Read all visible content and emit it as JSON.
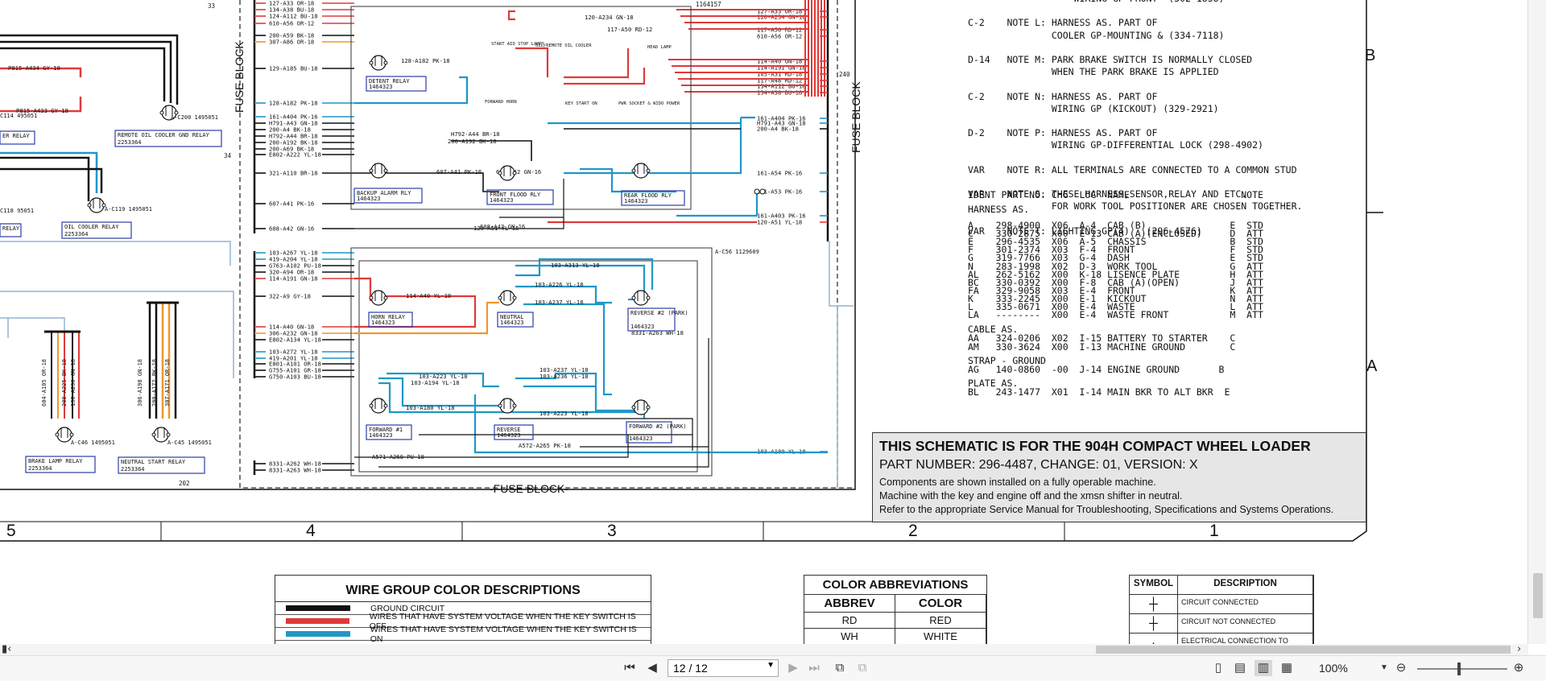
{
  "schematic": {
    "fuse_block_label": "FUSE BLOCK",
    "wire_labels_left": [
      "127-A33 OR-18",
      "134-A38 BU-18",
      "124-A112 BU-18",
      "610-A56 OR-12",
      "200-A59 BK-18",
      "307-A86 OR-18",
      "129-A185 BU-18",
      "128-A182 PK-18",
      "161-A404 PK-16",
      "H791-A43 GN-18",
      "200-A4 BK-18",
      "H792-A44 BR-18",
      "200-A192 BK-18",
      "200-A69 BK-18",
      "E802-A222 YL-18",
      "321-A110 BR-18",
      "607-A41 PK-16",
      "608-A42 GN-16",
      "103-A267 YL-18",
      "419-A204 YL-18",
      "G763-A102 PU-18",
      "320-A94 OR-18",
      "114-A191 GN-18",
      "322-A9 GY-18",
      "114-A40 GN-18",
      "306-A232 GN-18",
      "E802-A134 YL-18",
      "103-A272 YL-18",
      "419-A201 YL-18",
      "E801-A101 OR-18",
      "G755-A101 GR-18",
      "G750-A103 BU-18",
      "8331-A262 WH-18",
      "8331-A263 WH-18"
    ],
    "wire_labels_right": [
      "127-A33 OR-18",
      "120-A234 GN-18",
      "117-A50 RD-12",
      "610-A56 OR-12",
      "114-A40 GN-18",
      "114-A191 GN-18",
      "105-A31 RD-18",
      "117-A48 RD-12",
      "134-A112 BU-18",
      "134-A38 BU-18",
      "161-A404 PK-16",
      "H791-A43 GN-18",
      "200-A4 BK-18",
      "161-A54 PK-16",
      "161-A53 PK-16",
      "161-A403 PK-16",
      "120-A51 YL-18",
      "103-A180 YL-18"
    ],
    "wire_labels_mid": [
      "128-A182 PK-18",
      "P815-A434 GY-18",
      "P815-A433 GY-18",
      "607-A41 PK-16",
      "608-A42 GN-16",
      "120-A51 YL-18",
      "608-A42 GN-16",
      "H792-A44 BR-18",
      "200-A192 BK-18",
      "114-A40 YL-18",
      "103-A313 YL-18",
      "103-A226 YL-18",
      "103-A237 YL-18",
      "8331-A263 WH-18",
      "103-A223 YL-18",
      "103-A194 YL-18",
      "103-A180 YL-18",
      "103-A237 YL-18",
      "103-A236 YL-18",
      "103-A223 YL-18",
      "A572-A265 PK-18",
      "A571-A260 PU-18",
      "117-A50 RD-12",
      "120-A234 GN-18"
    ],
    "components": [
      {
        "name": "DETENT RELAY",
        "part": "1464323"
      },
      {
        "name": "BACKUP ALARM RLY",
        "part": "1464323"
      },
      {
        "name": "FRONT FLOOD RLY",
        "part": "1464323"
      },
      {
        "name": "REAR FLOOD RLY",
        "part": "1464323"
      },
      {
        "name": "HORN RELAY",
        "part": "1464323"
      },
      {
        "name": "NEUTRAL",
        "part": "1464323"
      },
      {
        "name": "REVERSE #2 (PARK)",
        "part": "1464323"
      },
      {
        "name": "FORWARD #1",
        "part": "1464323"
      },
      {
        "name": "REVERSE",
        "part": "1464323"
      },
      {
        "name": "FORWARD #2 (PARK)",
        "part": "1464323"
      },
      {
        "name": "REMOTE OIL COOLER GND RELAY",
        "part": "2253364"
      },
      {
        "name": "OIL COOLER RELAY",
        "part": "2253364"
      },
      {
        "name": "BRAKE LAMP RELAY",
        "part": "2253364"
      },
      {
        "name": "NEUTRAL START RELAY",
        "part": "2253364"
      },
      {
        "name": "ER RELAY",
        "part": ""
      },
      {
        "name": "RELAY",
        "part": ""
      }
    ],
    "connector_labels": [
      "A-C200 1495051",
      "A-C119 1495051",
      "A-C46 1495051",
      "A-C45 1495051",
      "A-C56 1129609",
      "C114 495051",
      "C118 95051"
    ],
    "small_labels": [
      "START AID STOP LAMPS",
      "OIL/REMOTE OIL COOLER",
      "HEAD LAMP",
      "FORWARD HORN",
      "KEY START ON",
      "PWR SOCKET & WIDO POWER"
    ],
    "vertical_wires": [
      "604-A105 OR-18",
      "200-A225 BK-18",
      "130-A236 GN-18",
      "306-A198 GN-18",
      "200-A172 BK-18",
      "307-A171 OR-18"
    ],
    "sheet_numbers": [
      "33",
      "34",
      "240",
      "202",
      "1164157"
    ]
  },
  "notes": {
    "lines": [
      "                   WIRING GP-FRONT  (302-1858)",
      "",
      "C-2    NOTE L: HARNESS AS. PART OF",
      "               COOLER GP-MOUNTING & (334-7118)",
      "",
      "D-14   NOTE M: PARK BRAKE SWITCH IS NORMALLY CLOSED",
      "               WHEN THE PARK BRAKE IS APPLIED",
      "",
      "C-2    NOTE N: HARNESS AS. PART OF",
      "               WIRING GP (KICKOUT) (329-2921)",
      "",
      "D-2    NOTE P: HARNESS AS. PART OF",
      "               WIRING GP-DIFFERENTIAL LOCK (298-4902)",
      "",
      "VAR    NOTE R: ALL TERMINALS ARE CONNECTED TO A COMMON STUD",
      "",
      "VAR    NOTE S: THESE HARNESS,SENSOR,RELAY AND ETC.",
      "               FOR WORK TOOL POSITIONER ARE CHOSEN TOGETHER.",
      "",
      "VAR    NOTE T: LIGHTING GP(4)   (296-4576)"
    ]
  },
  "parts": {
    "header": "IDENT PART NO. CHG  LOC  NAME                    NOTE",
    "harness_label": "HARNESS AS.",
    "harness": [
      "A    298-4900  X06  A-4  CAB (B)               E  STD",
      "C    330-2875  X00  E-13 CAB (A)(ENCLOSED)     D  ATT",
      "E    296-4535  X06  A-5  CHASSIS               B  STD",
      "F    301-2374  X03  F-4  FRONT                 F  STD",
      "G    319-7766  X03  G-4  DASH                  E  STD",
      "N    283-1998  X02  D-3  WORK TOOL             G  ATT",
      "AL   262-5162  X00  K-18 LISENCE PLATE         H  ATT",
      "BC   330-0392  X00  F-8  CAB (A)(OPEN)         J  ATT",
      "FA   329-9058  X03  E-4  FRONT                 K  ATT",
      "K    333-2245  X00  E-1  KICKOUT               N  ATT",
      "L    335-0671  X00  E-4  WASTE                 L  ATT",
      "LA   --------  X00  E-4  WASTE FRONT           M  ATT"
    ],
    "cable_label": "CABLE AS.",
    "cable": [
      "AA   324-0206  X02  I-15 BATTERY TO STARTER    C",
      "AM   330-3624  X00  I-13 MACHINE GROUND        C"
    ],
    "strap_label": "STRAP - GROUND",
    "strap": [
      "AG   140-0860  -00  J-14 ENGINE GROUND       B"
    ],
    "plate_label": "PLATE AS.",
    "plate": [
      "BL   243-1477  X01  I-14 MAIN BKR TO ALT BKR  E"
    ]
  },
  "title_block": {
    "title": "THIS SCHEMATIC IS FOR THE 904H COMPACT WHEEL LOADER",
    "part": "PART NUMBER: 296-4487, CHANGE: 01, VERSION: X",
    "line1": "Components are shown installed on a fully operable machine.",
    "line2": "Machine with the key and engine off and the xmsn shifter in neutral.",
    "line3": "Refer to the appropriate Service Manual for Troubleshooting, Specifications and Systems Operations."
  },
  "grid": {
    "columns": [
      "5",
      "4",
      "3",
      "2",
      "1"
    ],
    "rows": [
      "B",
      "A"
    ]
  },
  "wire_group_legend": {
    "title": "WIRE GROUP COLOR DESCRIPTIONS",
    "rows": [
      {
        "color": "#111111",
        "label": "GROUND CIRCUIT"
      },
      {
        "color": "#e03a3a",
        "label": "WIRES THAT HAVE SYSTEM VOLTAGE WHEN THE KEY SWITCH IS OFF"
      },
      {
        "color": "#1f97c8",
        "label": "WIRES THAT HAVE SYSTEM VOLTAGE WHEN THE KEY SWITCH IS ON"
      }
    ]
  },
  "color_abbrev": {
    "title": "COLOR ABBREVIATIONS",
    "col1": "ABBREV",
    "col2": "COLOR",
    "rows": [
      [
        "RD",
        "RED"
      ],
      [
        "WH",
        "WHITE"
      ]
    ]
  },
  "symbols": {
    "col1": "SYMBOL",
    "col2": "DESCRIPTION",
    "rows": [
      {
        "glyph": "┼",
        "label": "CIRCUIT CONNECTED"
      },
      {
        "glyph": "┼",
        "label": "CIRCUIT NOT CONNECTED"
      },
      {
        "glyph": "·",
        "label": "ELECTRICAL CONNECTION TO"
      }
    ]
  },
  "toolbar": {
    "page_value": "12 / 12",
    "zoom": "100%"
  }
}
